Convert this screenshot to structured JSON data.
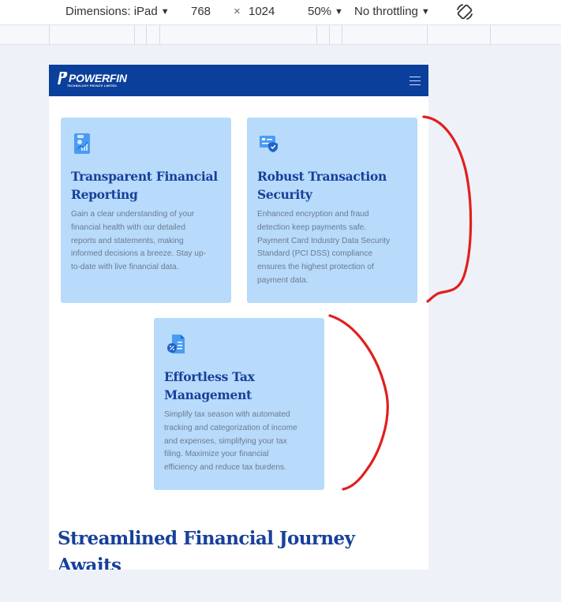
{
  "devtools": {
    "dimensions_label": "Dimensions: iPad",
    "width": "768",
    "times": "×",
    "height": "1024",
    "zoom": "50%",
    "throttling": "No throttling",
    "caret": "▼"
  },
  "site": {
    "logo_text": "POWERFIN",
    "logo_subtext": "TECHNOLOGY PRIVATE LIMITED",
    "header_color": "#0b3f9c",
    "accent_color": "#17409a",
    "card_color": "#b8dafb"
  },
  "cards": [
    {
      "icon": "report-icon",
      "title_line1": "Transparent Financial",
      "title_line2": "Reporting",
      "desc": [
        "Gain a clear understanding of your",
        "financial health with our detailed",
        "reports and statements, making",
        "informed decisions a breeze. Stay up-",
        "to-date with live financial data."
      ]
    },
    {
      "icon": "secure-card-icon",
      "title_line1": "Robust Transaction",
      "title_line2": "Security",
      "desc": [
        "Enhanced encryption and fraud",
        "detection keep payments safe.",
        "Payment Card Industry Data Security",
        "Standard (PCI DSS) compliance",
        "ensures the highest protection of",
        "payment data."
      ]
    },
    {
      "icon": "tax-document-icon",
      "title_line1": "Effortless Tax",
      "title_line2": "Management",
      "desc": [
        "Simplify tax season with automated",
        "tracking and categorization of income",
        "and expenses, simplifying your tax",
        "filing. Maximize your financial",
        "efficiency and reduce tax burdens."
      ]
    }
  ],
  "section": {
    "heading_line1": "Streamlined Financial Journey",
    "heading_line2": "Awaits"
  },
  "annotation_color": "#e0201d"
}
